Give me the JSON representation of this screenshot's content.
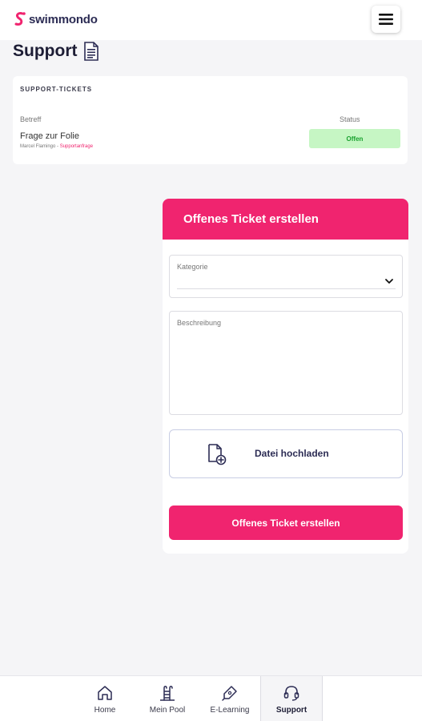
{
  "app": {
    "brand": "swimmondo",
    "brand_color": "#f0246f"
  },
  "header": {
    "menu_icon": "hamburger-menu-icon"
  },
  "page": {
    "title": "Support",
    "title_icon": "document-icon"
  },
  "tickets": {
    "heading": "SUPPORT-TICKETS",
    "columns": {
      "subject": "Betreff",
      "status": "Status"
    },
    "rows": [
      {
        "subject": "Frage zur Folie",
        "author": "Marcel Flamingo",
        "separator": " - ",
        "category": "Supportanfrage",
        "status": "Offen",
        "status_color": "#1aa12f"
      }
    ]
  },
  "form": {
    "title": "Offenes Ticket erstellen",
    "category_label": "Kategorie",
    "category_value": "",
    "description_label": "Beschreibung",
    "description_value": "",
    "upload_label": "Datei hochladen",
    "submit_label": "Offenes Ticket erstellen"
  },
  "nav": {
    "items": [
      {
        "label": "Home",
        "icon": "home-icon"
      },
      {
        "label": "Mein Pool",
        "icon": "pool-ladder-icon"
      },
      {
        "label": "E-Learning",
        "icon": "pen-icon"
      },
      {
        "label": "Support",
        "icon": "headset-icon",
        "active": true
      }
    ]
  }
}
